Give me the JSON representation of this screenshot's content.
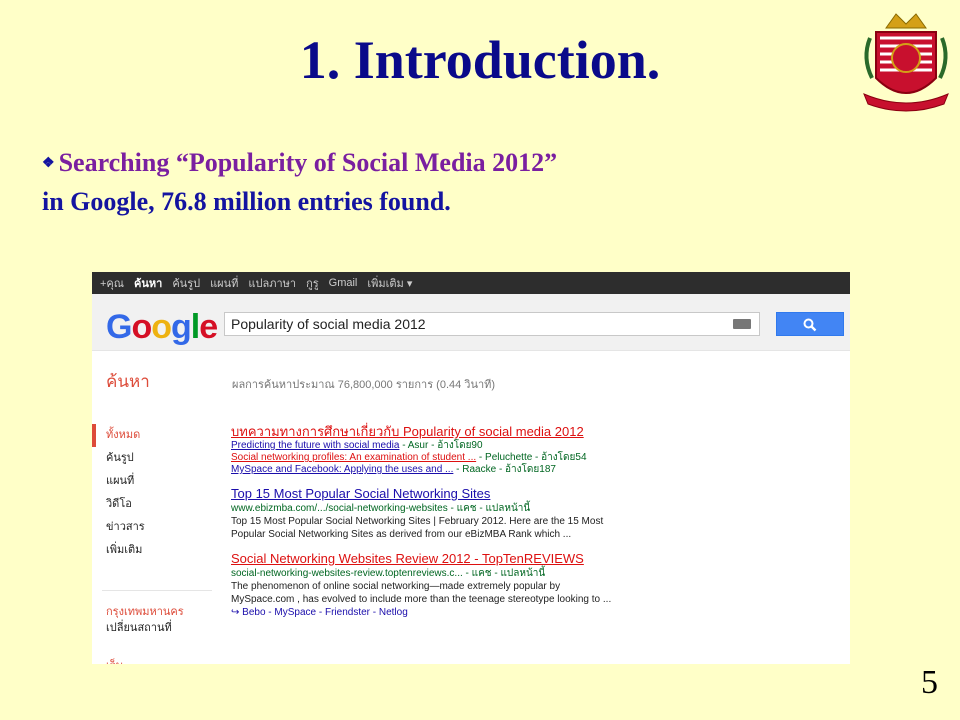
{
  "slide": {
    "title": "1. Introduction.",
    "bullet_line1": "Searching “Popularity of Social Media 2012”",
    "bullet_line2": "in Google, 76.8 million entries found.",
    "page_number": "5"
  },
  "google": {
    "topbar": [
      "+คุณ",
      "ค้นหา",
      "ค้นรูป",
      "แผนที่",
      "แปลภาษา",
      "กูรู",
      "Gmail",
      "เพิ่มเติม ▾"
    ],
    "logo": "Google",
    "query": "Popularity of social media 2012",
    "search_label": "ค้นหา",
    "stats": "ผลการค้นหาประมาณ 76,800,000 รายการ (0.44 วินาที)",
    "nav": [
      "ทั้งหมด",
      "ค้นรูป",
      "แผนที่",
      "วิดีโอ",
      "ข่าวสาร",
      "เพิ่มเติม"
    ],
    "location_title": "กรุงเทพมหานคร",
    "location_change": "เปลี่ยนสถานที่",
    "location_partial": "เว็บ",
    "results": [
      {
        "title": "บทความทางการศึกษาเกี่ยวกับ Popularity of social media 2012",
        "subs": [
          {
            "link": "Predicting the future with social media",
            "rest": " - Asur - อ้างโดย90"
          },
          {
            "link": "Social networking profiles: An examination of student ...",
            "rest": " - Peluchette - อ้างโดย54"
          },
          {
            "link": "MySpace and Facebook: Applying the uses and ...",
            "rest": " - Raacke - อ้างโดย187"
          }
        ]
      },
      {
        "title": "Top 15 Most Popular Social Networking Sites",
        "url": "www.ebizmba.com/.../social-networking-websites - แคช - แปลหน้านี้",
        "snippet1": "Top 15 Most Popular Social Networking Sites | February 2012. Here are the 15 Most",
        "snippet2": "Popular Social Networking Sites as derived from our eBizMBA Rank which ..."
      },
      {
        "title": "Social Networking Websites Review 2012 - TopTenREVIEWS",
        "url": "social-networking-websites-review.toptenreviews.c... - แคช - แปลหน้านี้",
        "snippet1": "The phenomenon of online social networking—made extremely popular by",
        "snippet2": "MySpace.com , has evolved to include more than the teenage stereotype looking to ...",
        "sitelinks": "↪ Bebo - MySpace - Friendster - Netlog"
      }
    ]
  },
  "colors": {
    "background": "#ffffc8",
    "title": "#0a0a8a",
    "bullet_purple": "#7a1fa0",
    "google_red": "#dd4b39"
  }
}
